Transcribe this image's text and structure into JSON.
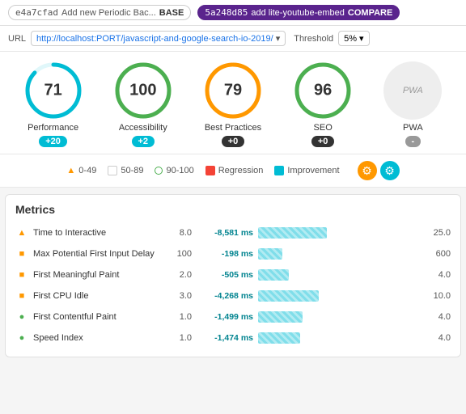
{
  "topBar": {
    "base": {
      "hash": "e4a7cfad",
      "desc": "Add new Periodic Bac...",
      "label": "BASE"
    },
    "compare": {
      "hash": "5a248d85",
      "desc": "add lite-youtube-embed",
      "label": "COMPARE"
    }
  },
  "urlBar": {
    "urlLabel": "URL",
    "url": "http://localhost:PORT/javascript-and-google-search-io-2019/",
    "thresholdLabel": "Threshold",
    "threshold": "5%"
  },
  "scores": [
    {
      "id": "performance",
      "label": "Performance",
      "value": 71,
      "badge": "+20",
      "badgeType": "teal",
      "color": "#00bcd4",
      "bg": "#e0f7fa",
      "strokeDash": "175,226",
      "type": "arc"
    },
    {
      "id": "accessibility",
      "label": "Accessibility",
      "value": 100,
      "badge": "+2",
      "badgeType": "teal",
      "color": "#4caf50",
      "bg": "#e8f5e9",
      "strokeDash": "226,226",
      "type": "arc"
    },
    {
      "id": "best-practices",
      "label": "Best Practices",
      "value": 79,
      "badge": "+0",
      "badgeType": "dark",
      "color": "#ff9800",
      "bg": "#fff3e0",
      "strokeDash": "199,226",
      "type": "arc"
    },
    {
      "id": "seo",
      "label": "SEO",
      "value": 96,
      "badge": "+0",
      "badgeType": "dark",
      "color": "#4caf50",
      "bg": "#e8f5e9",
      "strokeDash": "220,226",
      "type": "arc"
    },
    {
      "id": "pwa",
      "label": "PWA",
      "value": null,
      "badge": "-",
      "badgeType": "gray",
      "type": "pwa"
    }
  ],
  "legend": {
    "items": [
      {
        "id": "range-0-49",
        "icon": "▲",
        "label": "0-49",
        "type": "triangle"
      },
      {
        "id": "range-50-89",
        "label": "50-89",
        "type": "square"
      },
      {
        "id": "range-90-100",
        "label": "90-100",
        "type": "circle"
      },
      {
        "id": "regression",
        "label": "Regression",
        "type": "reg"
      },
      {
        "id": "improvement",
        "label": "Improvement",
        "type": "imp"
      }
    ]
  },
  "metrics": {
    "title": "Metrics",
    "rows": [
      {
        "id": "tti",
        "name": "Time to Interactive",
        "iconType": "triangle",
        "base": "8.0",
        "delta": "-8,581 ms",
        "barWidth": 85,
        "compare": "25.0"
      },
      {
        "id": "mpfid",
        "name": "Max Potential First Input Delay",
        "iconType": "square",
        "base": "100",
        "delta": "-198 ms",
        "barWidth": 30,
        "compare": "600"
      },
      {
        "id": "fmp",
        "name": "First Meaningful Paint",
        "iconType": "square",
        "base": "2.0",
        "delta": "-505 ms",
        "barWidth": 38,
        "compare": "4.0"
      },
      {
        "id": "fci",
        "name": "First CPU Idle",
        "iconType": "square",
        "base": "3.0",
        "delta": "-4,268 ms",
        "barWidth": 75,
        "compare": "10.0"
      },
      {
        "id": "fcp",
        "name": "First Contentful Paint",
        "iconType": "circle",
        "base": "1.0",
        "delta": "-1,499 ms",
        "barWidth": 55,
        "compare": "4.0"
      },
      {
        "id": "si",
        "name": "Speed Index",
        "iconType": "circle",
        "base": "1.0",
        "delta": "-1,474 ms",
        "barWidth": 52,
        "compare": "4.0"
      }
    ]
  }
}
